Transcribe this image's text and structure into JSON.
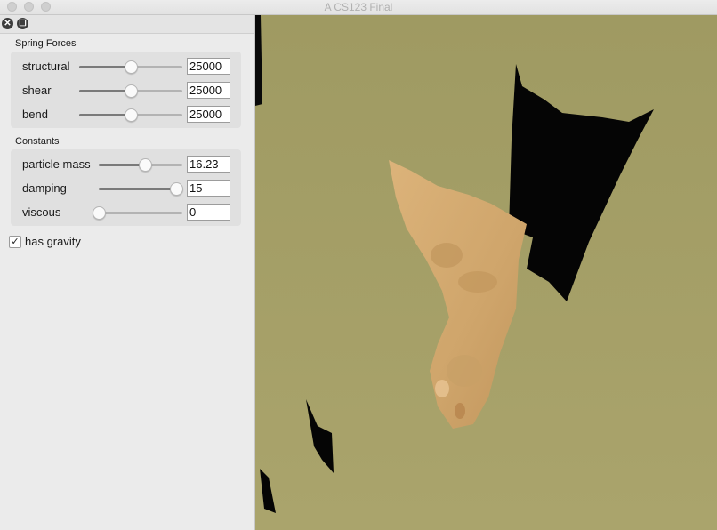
{
  "window": {
    "title": "A CS123 Final"
  },
  "panel": {
    "header_icons": {
      "close": "close-icon",
      "restore": "restore-icon"
    },
    "spring_forces": {
      "title": "Spring Forces",
      "controls": [
        {
          "label": "structural",
          "value": "25000",
          "level": 0.5
        },
        {
          "label": "shear",
          "value": "25000",
          "level": 0.5
        },
        {
          "label": "bend",
          "value": "25000",
          "level": 0.5
        }
      ]
    },
    "constants": {
      "title": "Constants",
      "controls": [
        {
          "label": "particle mass",
          "value": "16.23",
          "level": 0.55
        },
        {
          "label": "damping",
          "value": "15",
          "level": 0.93
        },
        {
          "label": "viscous",
          "value": "0",
          "level": 0.0
        }
      ]
    },
    "has_gravity": {
      "label": "has gravity",
      "checked": true
    }
  },
  "viewport": {
    "background_color": "#a19b64",
    "cloth_color": "#d2ab72"
  }
}
